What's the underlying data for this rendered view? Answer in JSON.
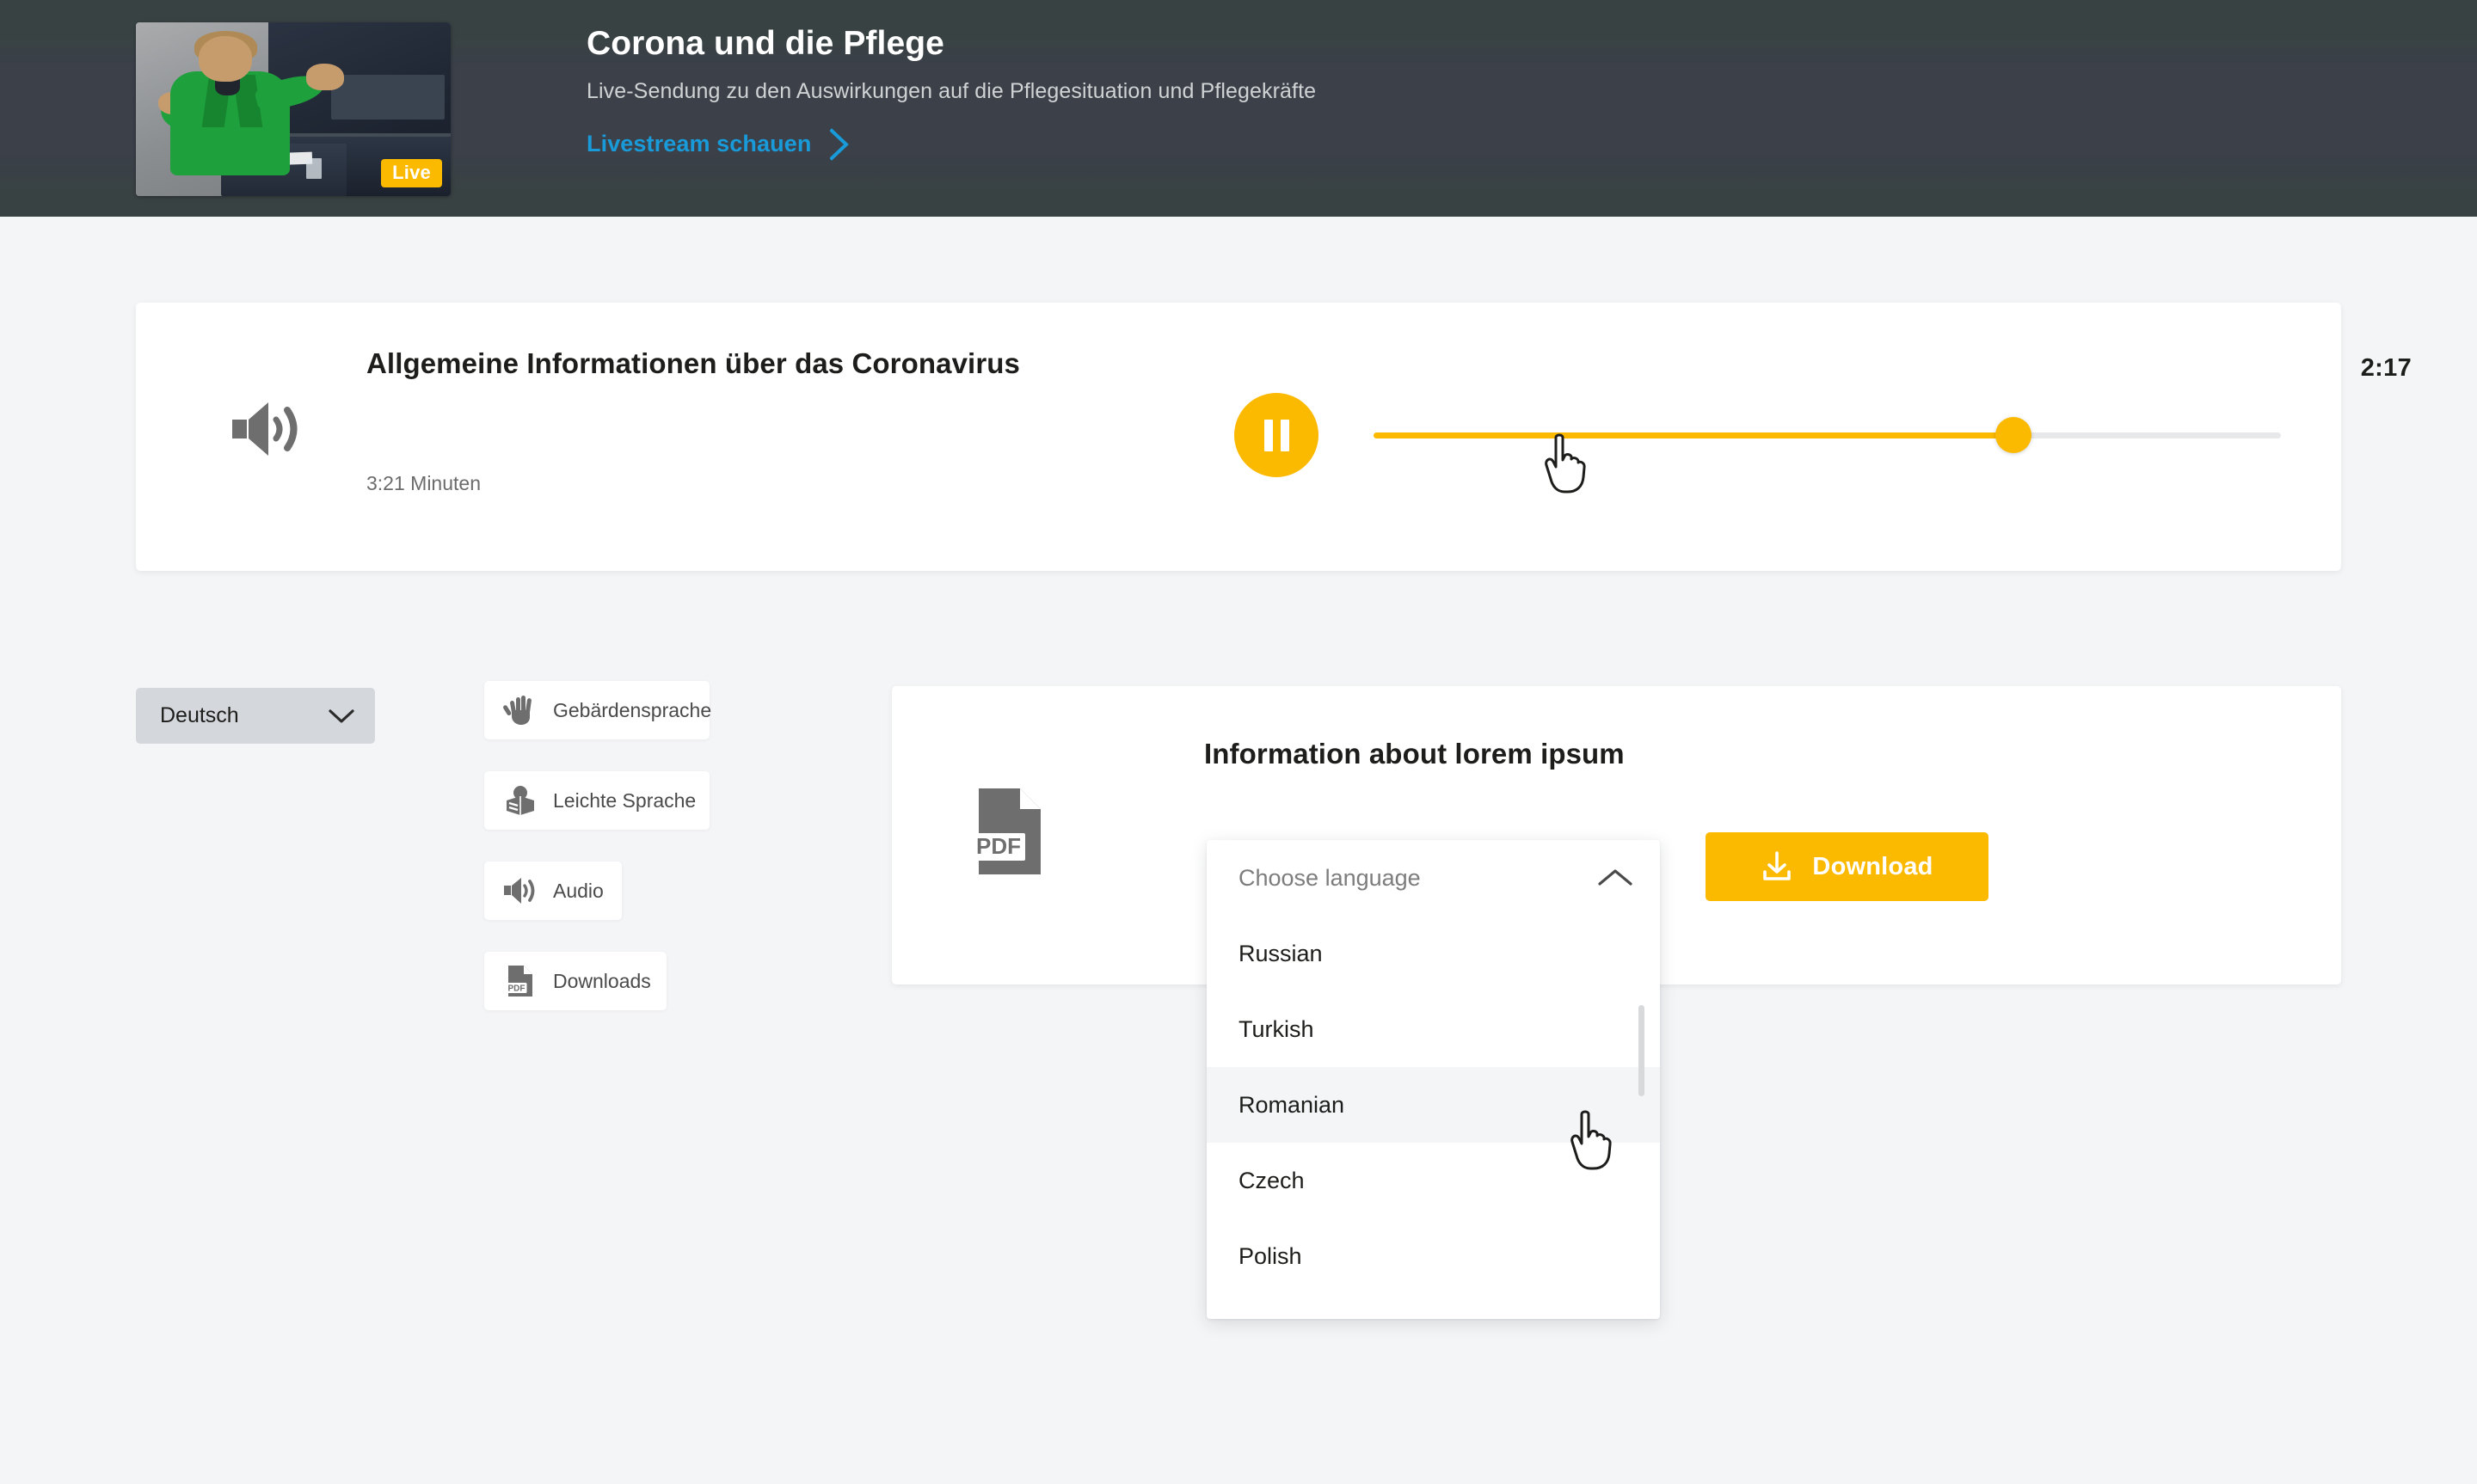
{
  "header": {
    "title": "Corona und die Pflege",
    "subtitle": "Live-Sendung zu den Auswirkungen auf die Pflegesituation und Pflegekräfte",
    "link_label": "Livestream schauen",
    "live_badge": "Live",
    "bg_color": "#3b4049",
    "link_color": "#199ad9"
  },
  "player": {
    "title": "Allgemeine Informationen über das Coronavirus",
    "duration": "3:21 Minuten",
    "current_time": "2:17",
    "progress_percent": 70.5,
    "state": "playing",
    "accent_color": "#fbb900"
  },
  "sidebar": {
    "language_select": {
      "value": "Deutsch"
    },
    "items": [
      {
        "label": "Gebärdensprache",
        "icon": "hand-icon"
      },
      {
        "label": "Leichte Sprache",
        "icon": "open-book-icon"
      },
      {
        "label": "Audio",
        "icon": "speaker-icon"
      },
      {
        "label": "Downloads",
        "icon": "pdf-file-icon"
      }
    ]
  },
  "download_card": {
    "title": "Information about lorem ipsum",
    "file_icon_label": "PDF",
    "button_label": "Download"
  },
  "language_dropdown": {
    "placeholder": "Choose language",
    "expanded": true,
    "options": [
      {
        "label": "Russian",
        "hovered": false
      },
      {
        "label": "Turkish",
        "hovered": false
      },
      {
        "label": "Romanian",
        "hovered": true
      },
      {
        "label": "Czech",
        "hovered": false
      },
      {
        "label": "Polish",
        "hovered": false
      }
    ]
  }
}
